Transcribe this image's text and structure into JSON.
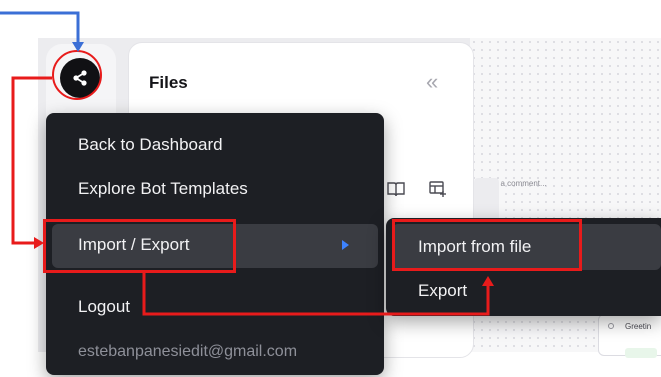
{
  "files_panel": {
    "title": "Files"
  },
  "main_menu": {
    "items": [
      {
        "label": "Back to Dashboard"
      },
      {
        "label": "Explore Bot Templates"
      },
      {
        "label": "Import / Export"
      },
      {
        "label": "Logout"
      }
    ],
    "user_email": "estebanpanesiedit@gmail.com"
  },
  "submenu": {
    "items": [
      {
        "label": "Import from file"
      },
      {
        "label": "Export"
      }
    ]
  },
  "canvas": {
    "comment_placeholder": "Add a comment...",
    "node_label": "Greetin"
  },
  "colors": {
    "annotation_blue": "#3b6fd6",
    "annotation_red": "#e81b1b",
    "menu_bg": "#1d1f24",
    "submenu_chevron": "#3d83ff"
  },
  "icons": [
    "share-icon",
    "collapse-double-chevron-icon",
    "book-icon",
    "table-add-icon",
    "chevron-right-icon"
  ]
}
